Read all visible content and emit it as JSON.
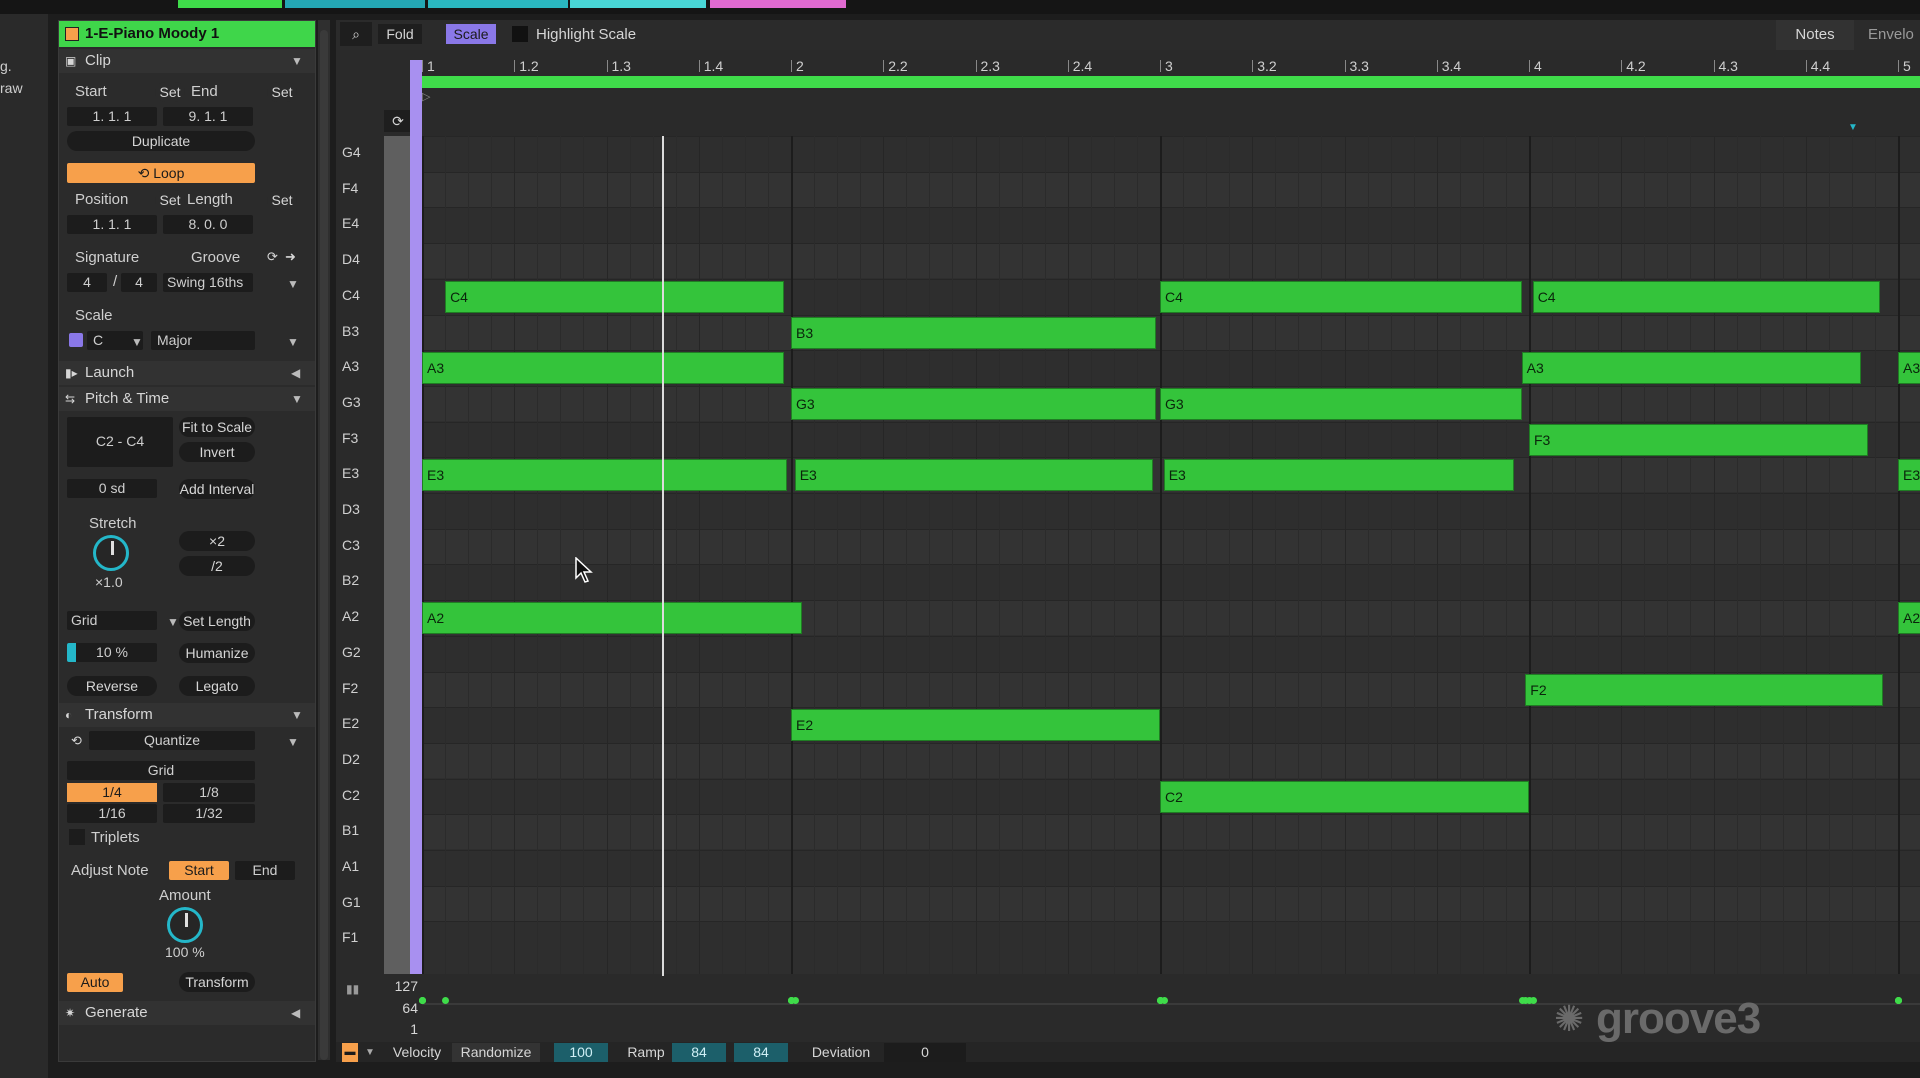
{
  "top_colors": [
    "#3fdc4a",
    "#24a7b4",
    "#2ab7c0",
    "#49d6d6",
    "#e06ad0"
  ],
  "sliver": {
    "line1": "g.",
    "line2": "raw"
  },
  "clip": {
    "title": "1-E-Piano Moody 1",
    "title_color": "#3fd64a",
    "section_clip": "Clip",
    "start_label": "Start",
    "set1": "Set",
    "end_label": "End",
    "set2": "Set",
    "start_value": "1.  1.  1",
    "end_value": "9.  1.  1",
    "duplicate": "Duplicate",
    "loop": "Loop",
    "position_label": "Position",
    "set3": "Set",
    "length_label": "Length",
    "set4": "Set",
    "position_value": "1.  1.  1",
    "length_value": "8.  0.  0",
    "signature_label": "Signature",
    "groove_label": "Groove",
    "sig_num": "4",
    "sig_slash": "/",
    "sig_den": "4",
    "groove_value": "Swing 16ths",
    "scale_label": "Scale",
    "scale_root": "C",
    "scale_mode": "Major",
    "section_launch": "Launch",
    "section_pitch": "Pitch & Time",
    "range_value": "C2 - C4",
    "fit_to_scale": "Fit to Scale",
    "invert": "Invert",
    "sd_value": "0 sd",
    "add_interval": "Add Interval",
    "stretch_label": "Stretch",
    "stretch_value": "×1.0",
    "x2": "×2",
    "div2": "/2",
    "grid_select": "Grid",
    "set_length": "Set Length",
    "humanize_value": "10 %",
    "humanize": "Humanize",
    "reverse": "Reverse",
    "legato": "Legato",
    "section_transform": "Transform",
    "quantize": "Quantize",
    "grid_label": "Grid",
    "q_options": [
      "1/4",
      "1/8",
      "1/16",
      "1/32"
    ],
    "triplets": "Triplets",
    "adjust_note": "Adjust Note",
    "adj_start": "Start",
    "adj_end": "End",
    "amount_label": "Amount",
    "amount_value": "100 %",
    "auto": "Auto",
    "transform_btn": "Transform",
    "section_generate": "Generate"
  },
  "toolbar": {
    "fold": "Fold",
    "scale": "Scale",
    "highlight_scale": "Highlight Scale",
    "notes_tab": "Notes",
    "envelopes_tab": "Envelo"
  },
  "ruler_labels": [
    "1",
    "1.2",
    "1.3",
    "1.4",
    "2",
    "2.2",
    "2.3",
    "2.4",
    "3",
    "3.2",
    "3.3",
    "3.4",
    "4",
    "4.2",
    "4.3",
    "4.4",
    "5"
  ],
  "key_labels": [
    "G4",
    "F4",
    "E4",
    "D4",
    "C4",
    "B3",
    "A3",
    "G3",
    "F3",
    "E3",
    "D3",
    "C3",
    "B2",
    "A2",
    "G2",
    "F2",
    "E2",
    "D2",
    "C2",
    "B1",
    "A1",
    "G1",
    "F1"
  ],
  "notes": [
    {
      "pitch": "C4",
      "start": 1.0625,
      "end": 1.98
    },
    {
      "pitch": "A3",
      "start": 1.0,
      "end": 1.98
    },
    {
      "pitch": "E3",
      "start": 1.0,
      "end": 1.99
    },
    {
      "pitch": "A2",
      "start": 1.0,
      "end": 2.03
    },
    {
      "pitch": "B3",
      "start": 2.0,
      "end": 2.99
    },
    {
      "pitch": "G3",
      "start": 2.0,
      "end": 2.99
    },
    {
      "pitch": "E3",
      "start": 2.01,
      "end": 2.98
    },
    {
      "pitch": "E2",
      "start": 2.0,
      "end": 3.0
    },
    {
      "pitch": "C4",
      "start": 3.0,
      "end": 3.98
    },
    {
      "pitch": "G3",
      "start": 3.0,
      "end": 3.98
    },
    {
      "pitch": "E3",
      "start": 3.01,
      "end": 3.96
    },
    {
      "pitch": "C2",
      "start": 3.0,
      "end": 4.0
    },
    {
      "pitch": "C4",
      "start": 4.01,
      "end": 4.95
    },
    {
      "pitch": "A3",
      "start": 3.98,
      "end": 4.9
    },
    {
      "pitch": "F3",
      "start": 4.0,
      "end": 4.92
    },
    {
      "pitch": "F2",
      "start": 3.99,
      "end": 4.96
    },
    {
      "pitch": "A3",
      "start": 5.0,
      "end": 5.2
    },
    {
      "pitch": "E3",
      "start": 5.0,
      "end": 5.2
    },
    {
      "pitch": "A2",
      "start": 5.0,
      "end": 5.2
    }
  ],
  "velocity_axis": {
    "max": "127",
    "mid": "64",
    "min": "1"
  },
  "bottom": {
    "velocity": "Velocity",
    "randomize": "Randomize",
    "randomize_value": "100",
    "ramp": "Ramp",
    "ramp_a": "84",
    "ramp_b": "84",
    "deviation": "Deviation",
    "deviation_value": "0"
  },
  "watermark": "groove3"
}
